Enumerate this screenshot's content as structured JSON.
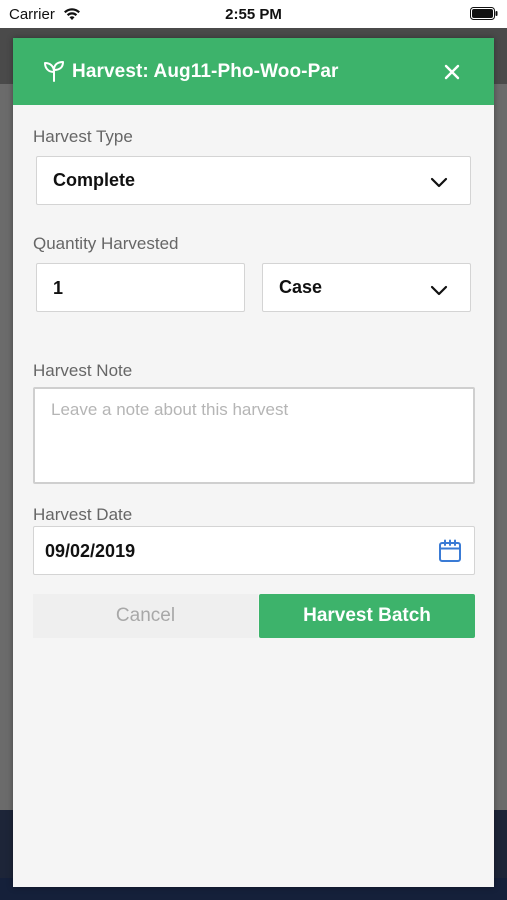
{
  "status_bar": {
    "carrier": "Carrier",
    "time": "2:55 PM"
  },
  "modal": {
    "title": "Harvest:  Aug11-Pho-Woo-Par",
    "header_color": "#3db36b",
    "icons": {
      "header": "sprout-icon",
      "close": "close-icon",
      "date": "calendar-icon"
    }
  },
  "form": {
    "harvest_type": {
      "label": "Harvest Type",
      "value": "Complete"
    },
    "quantity": {
      "label": "Quantity Harvested",
      "value": "1",
      "unit": "Case"
    },
    "note": {
      "label": "Harvest Note",
      "placeholder": "Leave a note about this harvest",
      "value": ""
    },
    "date": {
      "label": "Harvest Date",
      "value": "09/02/2019"
    }
  },
  "actions": {
    "cancel_label": "Cancel",
    "submit_label": "Harvest Batch"
  }
}
